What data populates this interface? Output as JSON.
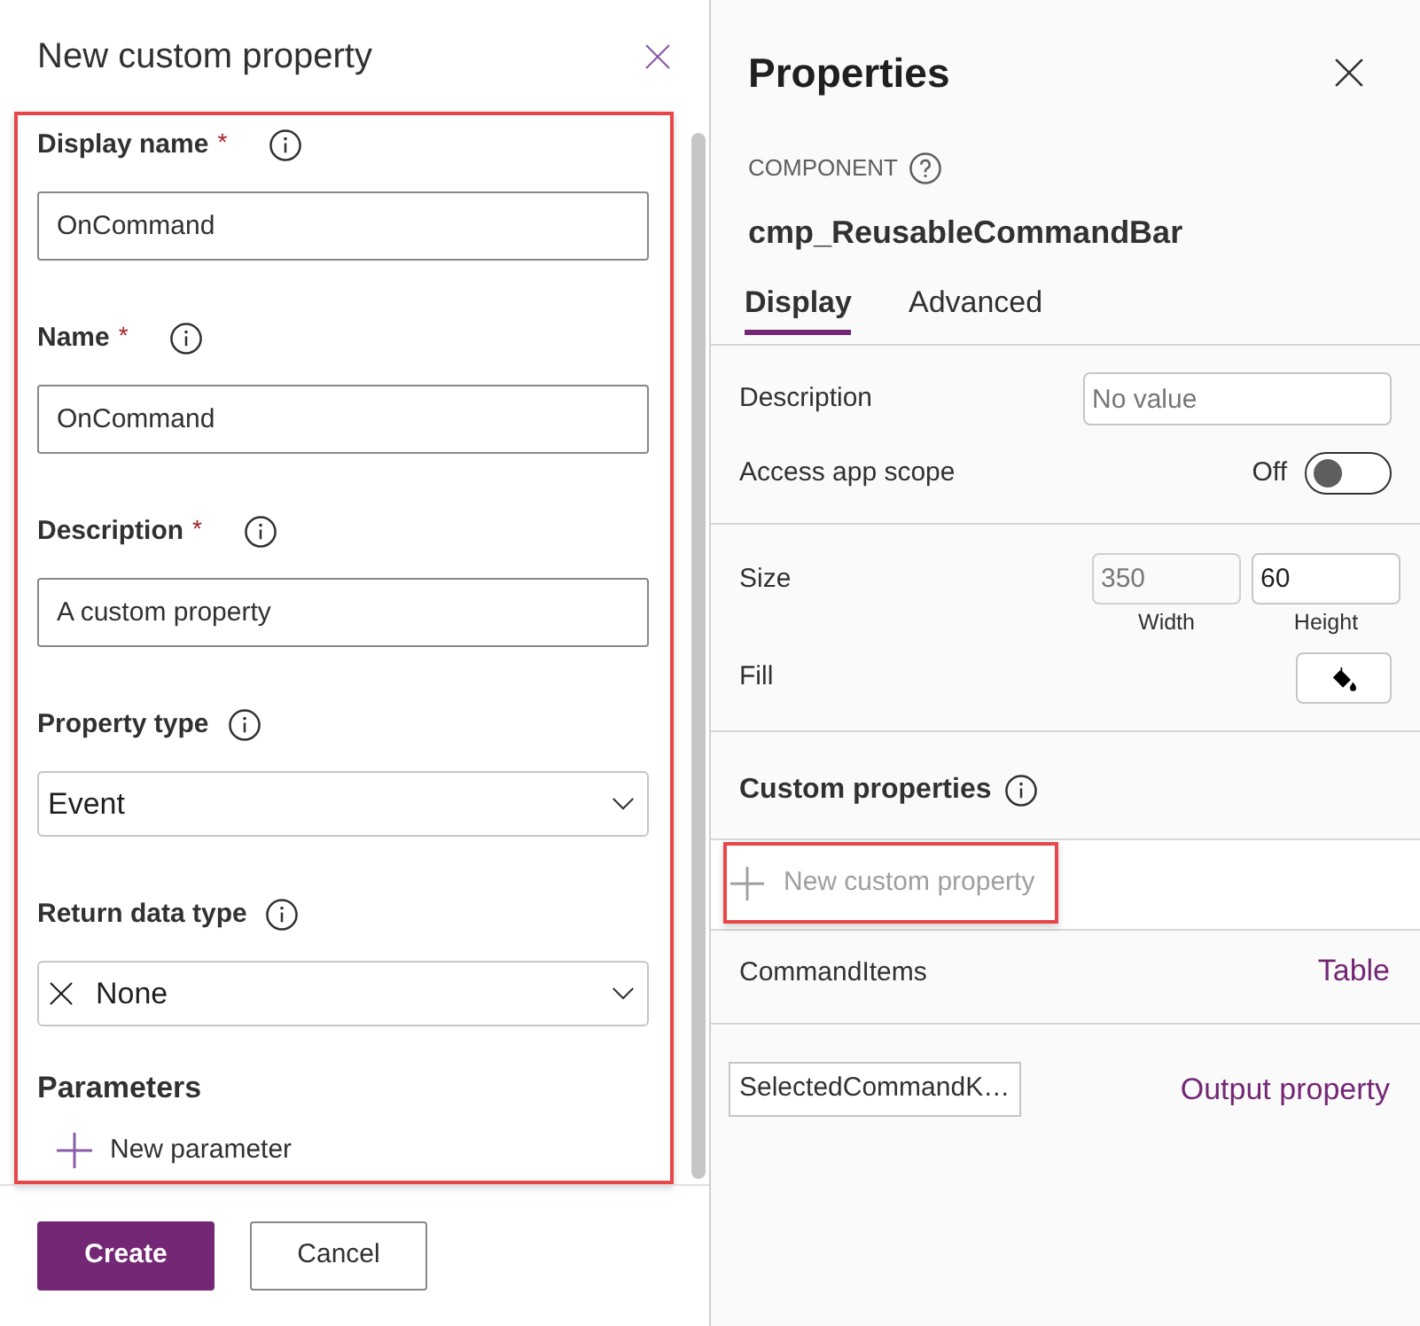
{
  "dialog": {
    "title": "New custom property",
    "highlighted": true,
    "fields": [
      {
        "kind": "text",
        "label": "Display name",
        "required_mark": "*",
        "value": "OnCommand"
      },
      {
        "kind": "text",
        "label": "Name",
        "required_mark": "*",
        "value": "OnCommand"
      },
      {
        "kind": "text",
        "label": "Description",
        "required_mark": "*",
        "value": "A custom property"
      },
      {
        "kind": "dropdown",
        "label": "Property type",
        "value": "Event"
      },
      {
        "kind": "dropdown",
        "label": "Return data type",
        "value": "None",
        "clear_icon": true
      }
    ],
    "parameters": {
      "heading": "Parameters",
      "add_label": "New parameter"
    },
    "buttons": [
      {
        "kind": "primary",
        "label": "Create"
      },
      {
        "kind": "secondary",
        "label": "Cancel"
      }
    ]
  },
  "properties_panel": {
    "title": "Properties",
    "section_label": "COMPONENT",
    "component_name": "cmp_ReusableCommandBar",
    "tabs": [
      {
        "label": "Display",
        "selected": true
      },
      {
        "label": "Advanced",
        "selected": false
      }
    ],
    "description": {
      "label": "Description",
      "placeholder": "No value"
    },
    "app_scope": {
      "label": "Access app scope",
      "state_label": "Off",
      "on": false
    },
    "size": {
      "label": "Size",
      "fields": [
        {
          "caption": "Width",
          "value": "350",
          "disabled": true
        },
        {
          "caption": "Height",
          "value": "60",
          "disabled": false
        }
      ]
    },
    "fill": {
      "label": "Fill"
    },
    "custom_properties": {
      "heading": "Custom properties",
      "add_label": "New custom property",
      "add_highlighted": true,
      "items": [
        {
          "kind": "input",
          "name": "CommandItems",
          "type": "Table"
        },
        {
          "kind": "output",
          "name": "SelectedCommandK…",
          "type": "Output property"
        }
      ]
    }
  }
}
